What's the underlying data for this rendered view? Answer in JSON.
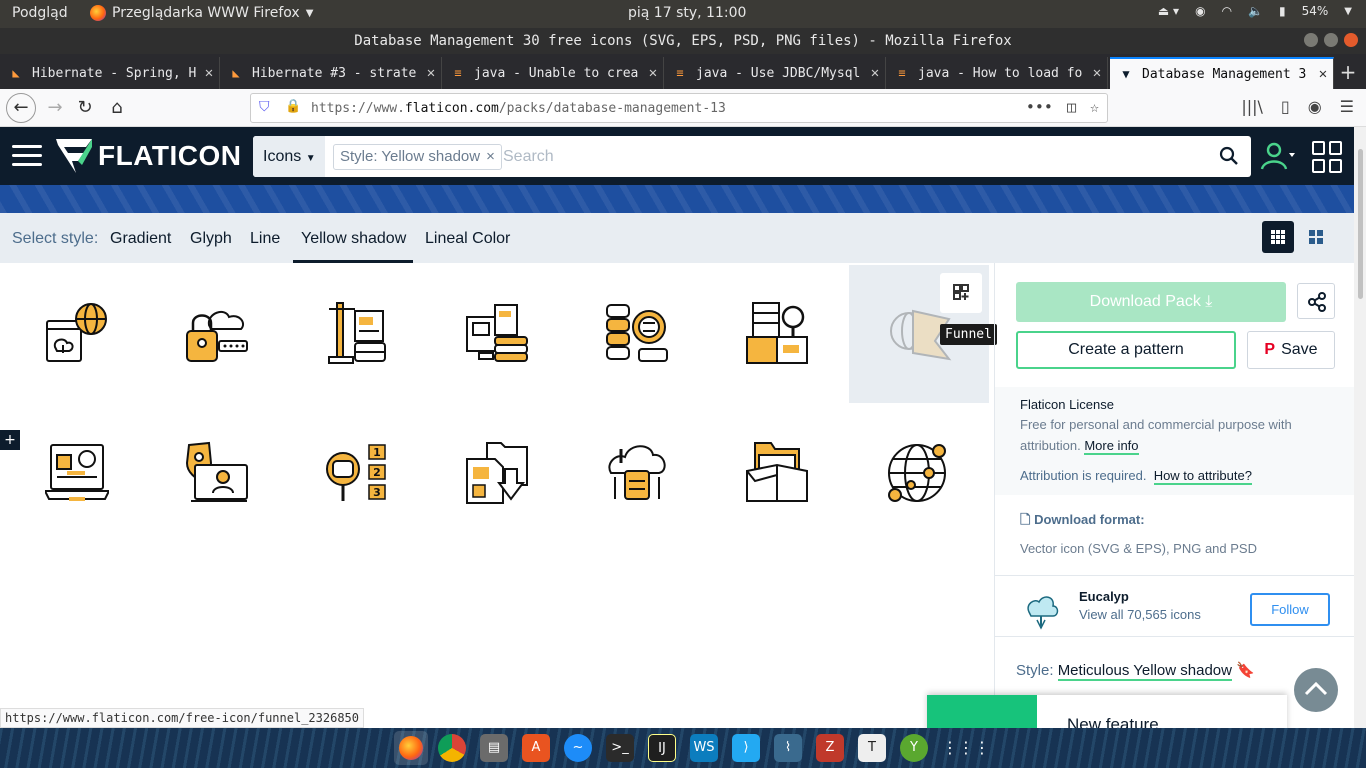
{
  "gnome_bar": {
    "activities": "Podgląd",
    "app_name": "Przeglądarka WWW Firefox",
    "clock": "pią 17 sty, 11:00",
    "battery": "54%"
  },
  "window": {
    "title": "Database Management 30 free icons (SVG, EPS, PSD, PNG files) - Mozilla Firefox"
  },
  "tabs": [
    {
      "label": "Hibernate - Spring, H",
      "icon": "hibernate-icon"
    },
    {
      "label": "Hibernate #3 - strate",
      "icon": "hibernate-icon"
    },
    {
      "label": "java - Unable to crea",
      "icon": "stackoverflow-icon"
    },
    {
      "label": "java - Use JDBC/Mysql",
      "icon": "stackoverflow-icon"
    },
    {
      "label": "java - How to load fo",
      "icon": "stackoverflow-icon"
    },
    {
      "label": "Database Management 3",
      "icon": "flaticon-icon",
      "active": true
    }
  ],
  "urlbar": {
    "prefix": "https://www.",
    "domain": "flaticon.com",
    "path": "/packs/database-management-13"
  },
  "site": {
    "logo_text": "FLATICON",
    "search_type": "Icons",
    "style_chip": "Style: Yellow shadow",
    "search_placeholder": "Search"
  },
  "style_bar": {
    "label": "Select style:",
    "options": [
      "Gradient",
      "Glyph",
      "Line",
      "Yellow shadow",
      "Lineal Color"
    ],
    "selected": "Yellow shadow"
  },
  "icons": [
    {
      "name": "cloud-upload-globe-icon"
    },
    {
      "name": "cloud-lock-icon"
    },
    {
      "name": "database-crane-icon"
    },
    {
      "name": "database-computer-icon"
    },
    {
      "name": "database-settings-icon"
    },
    {
      "name": "database-book-search-icon"
    },
    {
      "name": "funnel-icon",
      "hovered": true
    },
    {
      "name": "laptop-analytics-icon"
    },
    {
      "name": "laptop-security-user-icon"
    },
    {
      "name": "database-numbered-list-icon"
    },
    {
      "name": "folder-download-icon"
    },
    {
      "name": "cloud-warning-icon"
    },
    {
      "name": "box-folder-icon"
    },
    {
      "name": "globe-network-icon"
    }
  ],
  "tooltip": "Funnel",
  "sidebar": {
    "download_pack": "Download Pack",
    "create_pattern": "Create a pattern",
    "save": "Save",
    "license_title": "Flaticon License",
    "license_desc": "Free for personal and commercial purpose with attribution.",
    "more_info": "More info",
    "attribution_text": "Attribution is required.",
    "how_to_attribute": "How to attribute?",
    "format_title": "Download format:",
    "format_desc": "Vector icon (SVG & EPS), PNG and PSD",
    "author_name": "Eucalyp",
    "author_count": "View all 70,565 icons",
    "follow": "Follow",
    "style_label": "Style:",
    "style_name": "Meticulous Yellow shadow"
  },
  "new_feature": "New feature",
  "status_url": "https://www.flaticon.com/free-icon/funnel_2326850",
  "colors": {
    "header_bg": "#0d1c2c",
    "accent_green": "#4ad38b",
    "icon_yellow": "#f5b53f",
    "follow_blue": "#2f8ff0"
  }
}
